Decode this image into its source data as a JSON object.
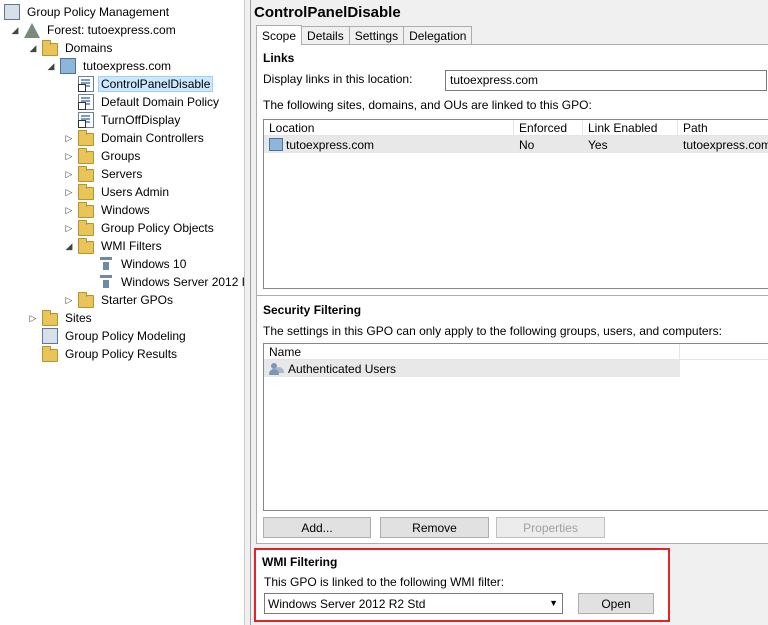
{
  "tree": {
    "root": "Group Policy Management",
    "forest": "Forest: tutoexpress.com",
    "domains": "Domains",
    "domain": "tutoexpress.com",
    "gpos": [
      "ControlPanelDisable",
      "Default Domain Policy",
      "TurnOffDisplay"
    ],
    "ous": [
      "Domain Controllers",
      "Groups",
      "Servers",
      "Users Admin",
      "Windows",
      "Group Policy Objects"
    ],
    "wmi_filters": "WMI Filters",
    "wmi_items": [
      "Windows 10",
      "Windows Server 2012 R"
    ],
    "starter": "Starter GPOs",
    "sites": "Sites",
    "modeling": "Group Policy Modeling",
    "results": "Group Policy Results"
  },
  "panel": {
    "title": "ControlPanelDisable",
    "tabs": [
      "Scope",
      "Details",
      "Settings",
      "Delegation"
    ],
    "links": {
      "heading": "Links",
      "display_label": "Display links in this location:",
      "display_value": "tutoexpress.com",
      "desc": "The following sites, domains, and OUs are linked to this GPO:",
      "columns": [
        "Location",
        "Enforced",
        "Link Enabled",
        "Path"
      ],
      "row": [
        "tutoexpress.com",
        "No",
        "Yes",
        "tutoexpress.com"
      ]
    },
    "security": {
      "heading": "Security Filtering",
      "desc": "The settings in this GPO can only apply to the following groups, users, and computers:",
      "column": "Name",
      "row": "Authenticated Users",
      "add": "Add...",
      "remove": "Remove",
      "properties": "Properties"
    },
    "wmi": {
      "heading": "WMI Filtering",
      "desc": "This GPO is linked to the following WMI filter:",
      "selected": "Windows Server 2012 R2 Std",
      "open": "Open"
    }
  },
  "colors": {
    "highlight_border": "#e2242a",
    "selection": "#cce8ff"
  }
}
